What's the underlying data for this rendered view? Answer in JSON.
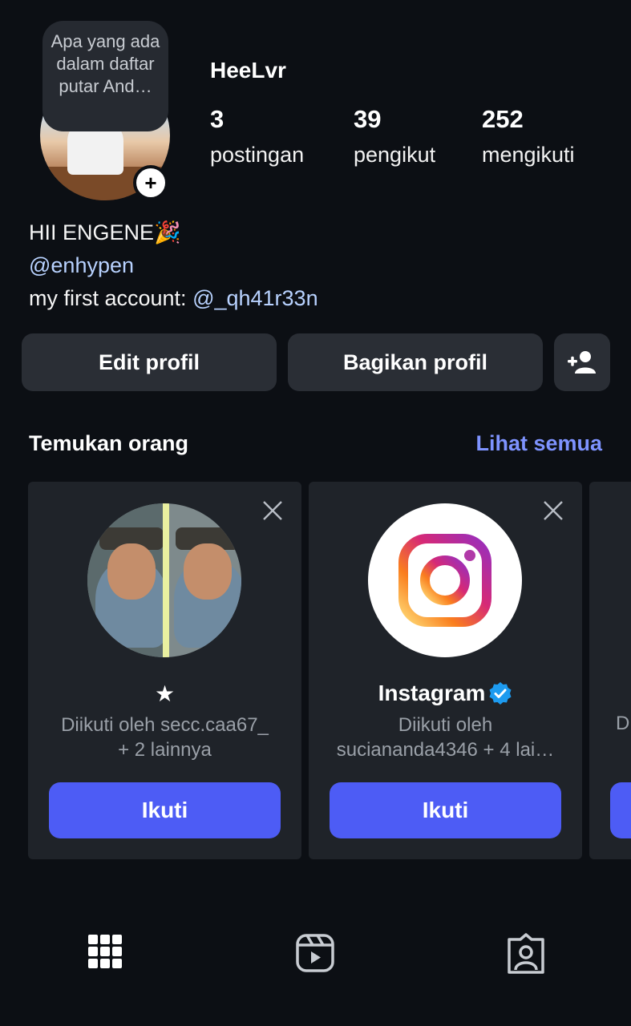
{
  "profile": {
    "note": "Apa yang ada dalam daftar putar And…",
    "username": "HeeLvr",
    "stats": [
      {
        "value": "3",
        "label": "postingan"
      },
      {
        "value": "39",
        "label": "pengikut"
      },
      {
        "value": "252",
        "label": "mengikuti"
      }
    ],
    "bio_line1": "HII ENGENE🎉",
    "bio_mention": "@enhypen",
    "bio_line3_prefix": "my first account: ",
    "bio_line3_mention": "@_qh41r33n"
  },
  "actions": {
    "edit": "Edit profil",
    "share": "Bagikan profil"
  },
  "discover": {
    "title": "Temukan orang",
    "see_all": "Lihat semua",
    "cards": [
      {
        "name": "★",
        "sub1": "Diikuti oleh secc.caa67_",
        "sub2": "+ 2 lainnya",
        "follow": "Ikuti",
        "verified": false
      },
      {
        "name": "Instagram",
        "sub1": "Diikuti oleh",
        "sub2": "suciananda4346 + 4 lai…",
        "follow": "Ikuti",
        "verified": true
      }
    ],
    "partial_card_text": "D"
  },
  "tabs": [
    {
      "icon": "grid-icon"
    },
    {
      "icon": "reels-icon"
    },
    {
      "icon": "tagged-icon"
    }
  ],
  "colors": {
    "background": "#0c0f14",
    "button": "#2a2e35",
    "follow": "#4d5cf5",
    "link": "#b8d2ff",
    "see_all": "#7e93ff",
    "verified": "#1d9bf0"
  }
}
